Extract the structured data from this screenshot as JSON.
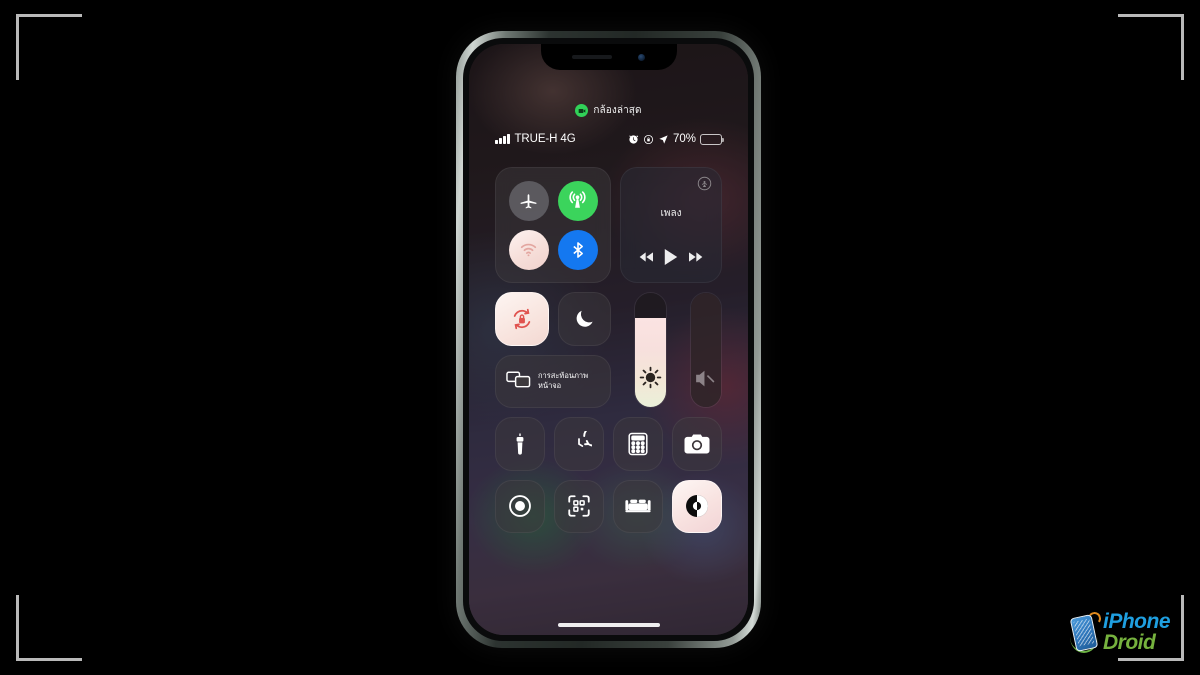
{
  "watermark": {
    "brand_part1": "iPhone",
    "brand_part2": "Droid",
    "icon": "phone-logo-icon"
  },
  "phone": {
    "model_hint": "iphone-x-frame",
    "camera_indicator": {
      "label": "กล้องล่าสุด",
      "icon": "camera-recording-icon",
      "color": "#31d158"
    },
    "status_bar": {
      "signal_icon": "cellular-bars-icon",
      "carrier": "TRUE-H 4G",
      "alarm_icon": "alarm-clock-icon",
      "rotation_lock_icon": "rotation-lock-icon",
      "location_icon": "location-arrow-icon",
      "battery_percent": "70%",
      "battery_level": 70,
      "battery_icon": "battery-icon"
    },
    "control_center": {
      "connectivity": {
        "name": "connectivity-module",
        "toggles": [
          {
            "name": "airplane-mode",
            "icon": "airplane-icon",
            "state": "off"
          },
          {
            "name": "cellular-data",
            "icon": "cellular-antenna-icon",
            "state": "on"
          },
          {
            "name": "wifi",
            "icon": "wifi-icon",
            "state": "on"
          },
          {
            "name": "bluetooth",
            "icon": "bluetooth-icon",
            "state": "on"
          }
        ]
      },
      "media": {
        "name": "now-playing-module",
        "title": "เพลง",
        "airplay_icon": "airplay-audio-icon",
        "controls": [
          {
            "name": "rewind-button",
            "icon": "rewind-icon"
          },
          {
            "name": "play-button",
            "icon": "play-icon"
          },
          {
            "name": "fast-forward-button",
            "icon": "fast-forward-icon"
          }
        ]
      },
      "rotation_lock": {
        "name": "rotation-lock-toggle",
        "icon": "rotation-lock-icon",
        "state": "on"
      },
      "do_not_disturb": {
        "name": "do-not-disturb-toggle",
        "icon": "moon-icon",
        "state": "off"
      },
      "screen_mirroring": {
        "name": "screen-mirroring-button",
        "icon": "screen-mirroring-icon",
        "label_line1": "การสะท้อนภาพ",
        "label_line2": "หน้าจอ"
      },
      "brightness": {
        "name": "brightness-slider",
        "icon": "brightness-icon",
        "value": 78
      },
      "volume": {
        "name": "volume-slider",
        "icon": "volume-mute-icon",
        "value": 0,
        "muted": true
      },
      "shortcuts_row1": [
        {
          "name": "flashlight-button",
          "icon": "flashlight-icon",
          "state": "off"
        },
        {
          "name": "timer-button",
          "icon": "timer-icon",
          "state": "off"
        },
        {
          "name": "calculator-button",
          "icon": "calculator-icon",
          "state": "off"
        },
        {
          "name": "camera-button",
          "icon": "camera-icon",
          "state": "off"
        }
      ],
      "shortcuts_row2": [
        {
          "name": "screen-recording-button",
          "icon": "screen-record-icon",
          "state": "off"
        },
        {
          "name": "qr-scanner-button",
          "icon": "qr-code-icon",
          "state": "off"
        },
        {
          "name": "sleep-mode-button",
          "icon": "bed-icon",
          "state": "off"
        },
        {
          "name": "dark-mode-button",
          "icon": "dark-mode-contrast-icon",
          "state": "on"
        }
      ]
    },
    "home_indicator": "home-indicator"
  },
  "colors": {
    "accent_green": "#3bd45c",
    "accent_blue": "#1478f0",
    "camera_dot": "#31d158",
    "active_tile": "#fdf5f2",
    "rotation_lock_red": "#e0524e",
    "bracket": "#b9b9b9",
    "background": "#000000"
  }
}
